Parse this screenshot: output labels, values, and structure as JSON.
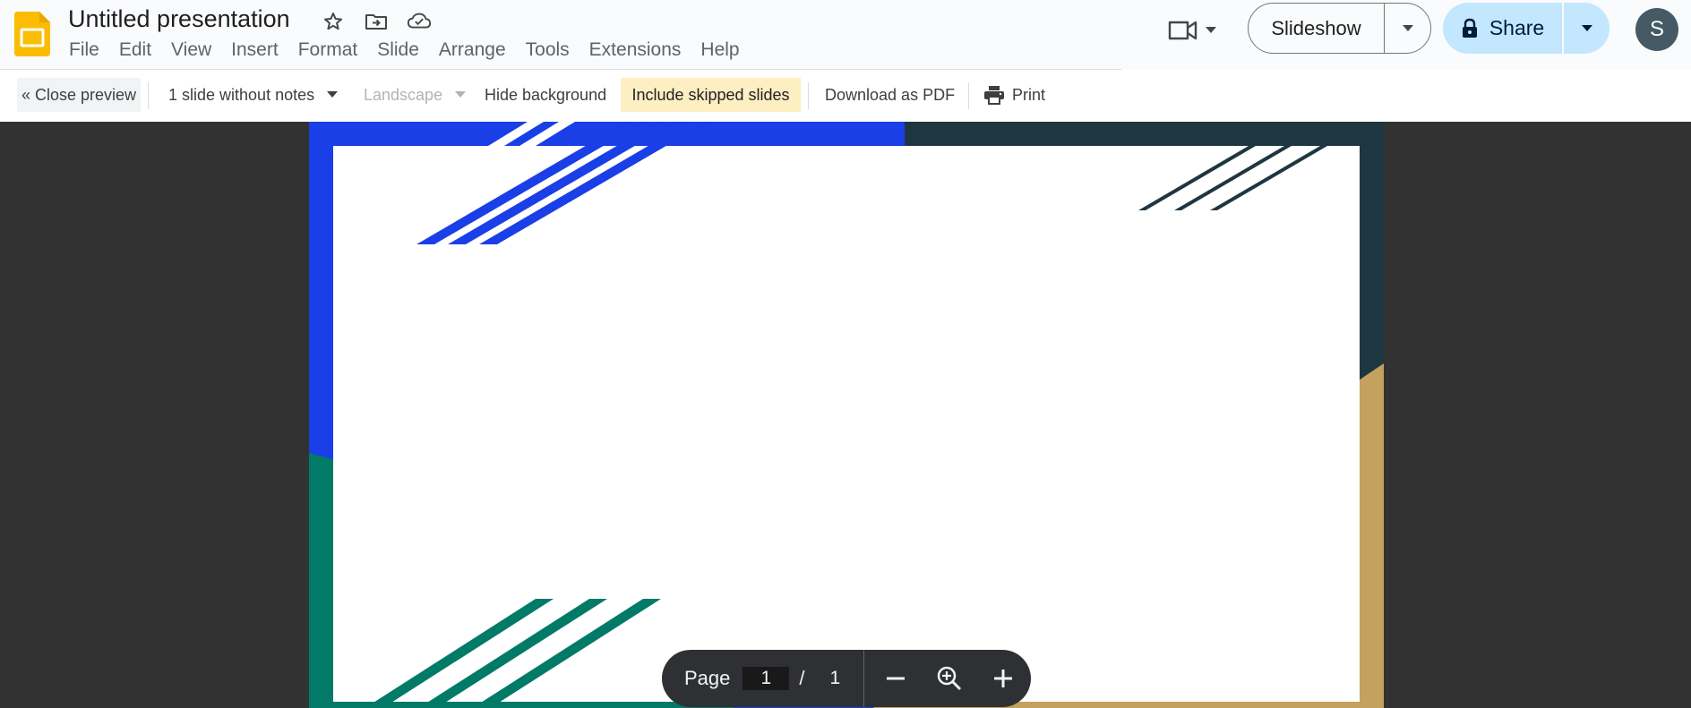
{
  "app": {
    "document_title": "Untitled presentation",
    "avatar_initial": "S"
  },
  "menu": [
    "File",
    "Edit",
    "View",
    "Insert",
    "Format",
    "Slide",
    "Arrange",
    "Tools",
    "Extensions",
    "Help"
  ],
  "header_buttons": {
    "slideshow_label": "Slideshow",
    "share_label": "Share"
  },
  "toolbar": {
    "close_preview": "« Close preview",
    "notes_layout": "1 slide without notes",
    "orientation": "Landscape",
    "hide_background": "Hide background",
    "include_skipped": "Include skipped slides",
    "download_pdf": "Download as PDF",
    "print": "Print"
  },
  "page_controls": {
    "page_label": "Page",
    "current_page": "1",
    "separator": "/",
    "total_pages": "1"
  },
  "colors": {
    "slides_yellow": "#fbbc04",
    "slide_blue": "#1a3fe6",
    "slide_teal": "#017a68",
    "slide_dark_teal": "#1e3640",
    "slide_gold": "#c4a15f",
    "active_toggle_bg": "#feefc3",
    "share_bg": "#c2e7ff",
    "viewer_bg": "#323232"
  },
  "icons": [
    "slides-logo-icon",
    "star-icon",
    "move-to-folder-icon",
    "cloud-saved-icon",
    "video-camera-icon",
    "lock-icon",
    "dropdown-arrow-icon",
    "printer-icon",
    "zoom-out-icon",
    "zoom-fit-icon",
    "zoom-in-icon"
  ]
}
